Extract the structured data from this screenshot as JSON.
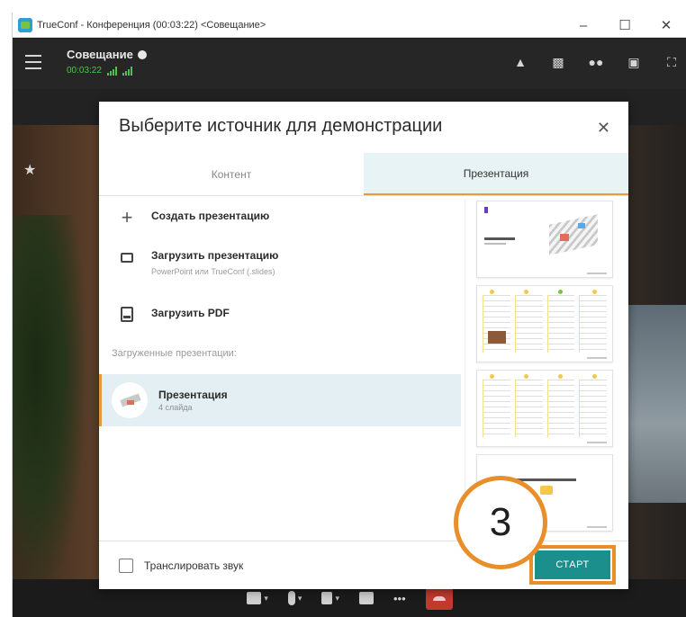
{
  "window": {
    "title": "TrueConf - Конференция (00:03:22) <Совещание>",
    "minimize": "–",
    "maximize": "☐",
    "close": "✕"
  },
  "header": {
    "conference_name": "Совещание",
    "timer": "00:03:22",
    "icons": [
      "bell-icon",
      "chat-icon",
      "participants-icon",
      "screen-share-icon",
      "fullscreen-icon"
    ]
  },
  "modal": {
    "title": "Выберите источник для демонстрации",
    "close": "✕",
    "tabs": [
      {
        "label": "Контент",
        "active": false
      },
      {
        "label": "Презентация",
        "active": true
      }
    ],
    "actions": [
      {
        "label": "Создать презентацию",
        "sub": ""
      },
      {
        "label": "Загрузить презентацию",
        "sub": "PowerPoint или TrueConf (.slides)"
      },
      {
        "label": "Загрузить PDF",
        "sub": ""
      }
    ],
    "uploaded_label": "Загруженные презентации:",
    "presentation": {
      "name": "Презентация",
      "count": "4 слайда"
    },
    "broadcast_sound_label": "Транслировать звук",
    "broadcast_sound_checked": false,
    "start_label": "СТАРТ"
  },
  "callout": {
    "step": "3"
  },
  "colors": {
    "accent": "#e88e2a",
    "start_button": "#1a8f8c",
    "selected_row": "#e3eff3",
    "signal_green": "#4fc24f"
  }
}
